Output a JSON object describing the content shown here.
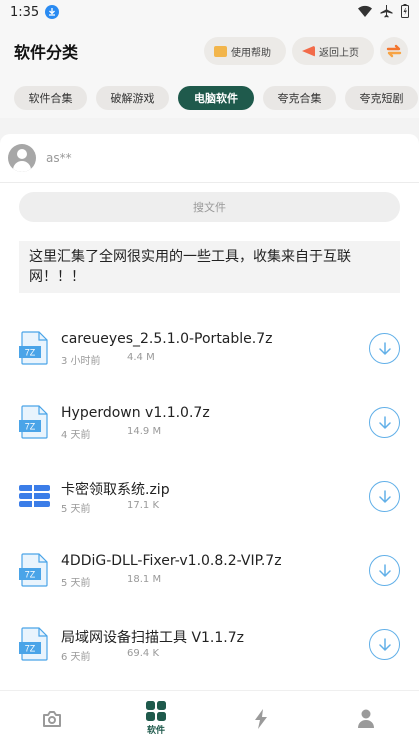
{
  "status_bar": {
    "time": "1:35"
  },
  "header": {
    "title": "软件分类",
    "help_label": "使用帮助",
    "back_label": "返回上页"
  },
  "tabs": [
    {
      "label": "软件合集",
      "active": false
    },
    {
      "label": "破解游戏",
      "active": false
    },
    {
      "label": "电脑软件",
      "active": true
    },
    {
      "label": "夸克合集",
      "active": false
    },
    {
      "label": "夸克短剧",
      "active": false
    }
  ],
  "user": {
    "name": "as**"
  },
  "search": {
    "placeholder": "搜文件"
  },
  "notice": {
    "text": "这里汇集了全网很实用的一些工具，收集来自于互联网！！！"
  },
  "files": [
    {
      "name": "careueyes_2.5.1.0-Portable.7z",
      "time": "3 小时前",
      "size": "4.4 M",
      "icon": "7z-file-icon"
    },
    {
      "name": "Hyperdown v1.1.0.7z",
      "time": "4 天前",
      "size": "14.9 M",
      "icon": "7z-file-icon"
    },
    {
      "name": "卡密领取系统.zip",
      "time": "5 天前",
      "size": "17.1 K",
      "icon": "zip-file-icon"
    },
    {
      "name": "4DDiG-DLL-Fixer-v1.0.8.2-VIP.7z",
      "time": "5 天前",
      "size": "18.1 M",
      "icon": "7z-file-icon"
    },
    {
      "name": "局域网设备扫描工具 V1.1.7z",
      "time": "6 天前",
      "size": "69.4 K",
      "icon": "7z-file-icon"
    }
  ],
  "bottom_nav": [
    {
      "label": "",
      "icon": "camera-icon",
      "active": false
    },
    {
      "label": "软件",
      "icon": "grid-icon",
      "active": true
    },
    {
      "label": "",
      "icon": "bolt-icon",
      "active": false
    },
    {
      "label": "",
      "icon": "person-icon",
      "active": false
    }
  ],
  "colors": {
    "accent": "#1f5a4c",
    "download": "#62b0e8",
    "file_icon": "#4aa4e8"
  }
}
